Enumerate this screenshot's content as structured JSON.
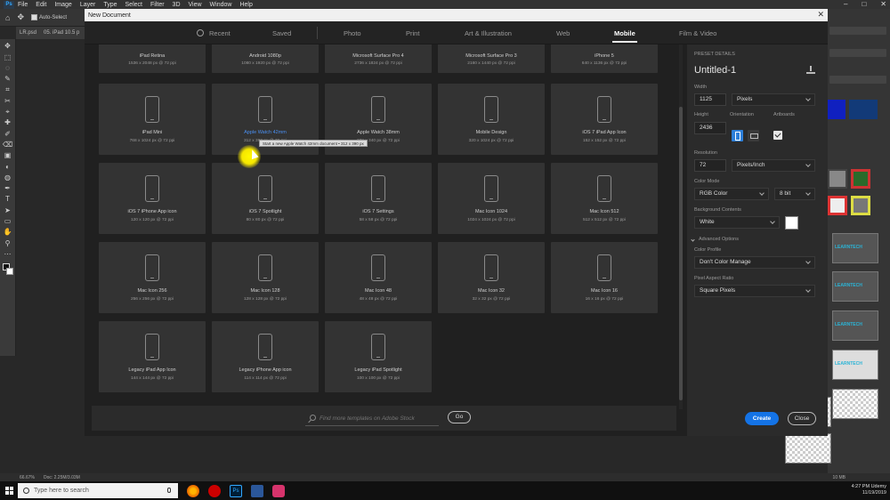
{
  "photoshop": {
    "logo": "Ps",
    "menu": [
      "File",
      "Edit",
      "Image",
      "Layer",
      "Type",
      "Select",
      "Filter",
      "3D",
      "View",
      "Window",
      "Help"
    ],
    "options": {
      "auto_select": "Auto-Select"
    },
    "doc_tabs": [
      "LR.psd",
      "05. iPad 10.5 p"
    ],
    "status": {
      "zoom": "66.67%",
      "doc": "Doc: 2.25M/3.03M",
      "mem": "10 MB"
    },
    "brand_color": "#31a8ff"
  },
  "dialog": {
    "title": "New Document",
    "tabs": [
      {
        "label": "Recent",
        "active": false
      },
      {
        "label": "Saved",
        "active": false
      },
      {
        "label": "Photo",
        "active": false
      },
      {
        "label": "Print",
        "active": false
      },
      {
        "label": "Art & Illustration",
        "active": false
      },
      {
        "label": "Web",
        "active": false
      },
      {
        "label": "Mobile",
        "active": true
      },
      {
        "label": "Film & Video",
        "active": false
      }
    ],
    "presets_top": [
      {
        "name": "iPad Retina",
        "size": "1536 x 2048 px @ 72 ppi"
      },
      {
        "name": "Android 1080p",
        "size": "1080 x 1920 px @ 72 ppi"
      },
      {
        "name": "Microsoft Surface Pro 4",
        "size": "2736 x 1824 px @ 72 ppi"
      },
      {
        "name": "Microsoft Surface Pro 3",
        "size": "2160 x 1440 px @ 72 ppi"
      },
      {
        "name": "iPhone 5",
        "size": "640 x 1136 px @ 72 ppi"
      }
    ],
    "presets": [
      {
        "name": "iPad Mini",
        "size": "768 x 1024 px @ 72 ppi"
      },
      {
        "name": "Apple Watch 42mm",
        "size": "312 x 390 px @ 72 ppi"
      },
      {
        "name": "Apple Watch 38mm",
        "size": "272 x 340 px @ 72 ppi"
      },
      {
        "name": "Mobile Design",
        "size": "320 x 1024 px @ 72 ppi"
      },
      {
        "name": "iOS 7 iPad App Icon",
        "size": "152 x 152 px @ 72 ppi"
      },
      {
        "name": "iOS 7 iPhone App icon",
        "size": "120 x 120 px @ 72 ppi"
      },
      {
        "name": "iOS 7 Spotlight",
        "size": "80 x 80 px @ 72 ppi"
      },
      {
        "name": "iOS 7 Settings",
        "size": "58 x 58 px @ 72 ppi"
      },
      {
        "name": "Mac Icon 1024",
        "size": "1024 x 1024 px @ 72 ppi"
      },
      {
        "name": "Mac Icon 512",
        "size": "512 x 512 px @ 72 ppi"
      },
      {
        "name": "Mac Icon 256",
        "size": "256 x 256 px @ 72 ppi"
      },
      {
        "name": "Mac Icon 128",
        "size": "128 x 128 px @ 72 ppi"
      },
      {
        "name": "Mac Icon 48",
        "size": "48 x 48 px @ 72 ppi"
      },
      {
        "name": "Mac Icon 32",
        "size": "32 x 32 px @ 72 ppi"
      },
      {
        "name": "Mac Icon 16",
        "size": "16 x 16 px @ 72 ppi"
      },
      {
        "name": "Legacy iPad App Icon",
        "size": "144 x 144 px @ 72 ppi"
      },
      {
        "name": "Legacy iPhone App icon",
        "size": "114 x 114 px @ 72 ppi"
      },
      {
        "name": "Legacy iPad Spotlight",
        "size": "100 x 100 px @ 72 ppi"
      }
    ],
    "tooltip": "Start a new Apple Watch 42mm document • 312 x 390 px",
    "search": {
      "placeholder": "Find more templates on Adobe Stock",
      "go": "Go"
    },
    "details": {
      "section": "PRESET DETAILS",
      "doc_name": "Untitled-1",
      "width_label": "Width",
      "width_value": "1125",
      "width_unit": "Pixels",
      "height_label": "Height",
      "height_value": "2436",
      "orientation_label": "Orientation",
      "artboards_label": "Artboards",
      "resolution_label": "Resolution",
      "resolution_value": "72",
      "resolution_unit": "Pixels/Inch",
      "color_mode_label": "Color Mode",
      "color_mode": "RGB Color",
      "bit_depth": "8 bit",
      "bg_label": "Background Contents",
      "bg_value": "White",
      "advanced": "Advanced Options",
      "profile_label": "Color Profile",
      "profile_value": "Don't Color Manage",
      "par_label": "Pixel Aspect Ratio",
      "par_value": "Square Pixels"
    },
    "create": "Create",
    "close": "Close",
    "accent": "#1473e6"
  },
  "right_panel_thumbs": [
    "LEARNTECH",
    "LEARNTECH",
    "LEARNTECH",
    "LEARNTECH"
  ],
  "taskbar": {
    "search_placeholder": "Type here to search",
    "time": "4:27 PM",
    "date": "11/19/2019",
    "tray_label": "Udemy"
  }
}
